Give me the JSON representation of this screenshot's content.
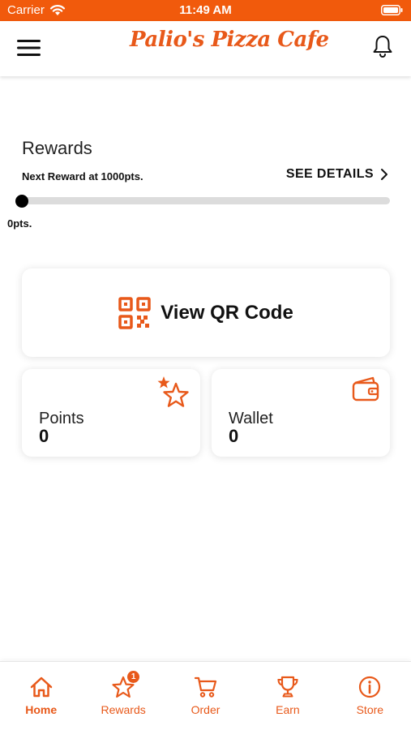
{
  "status_bar": {
    "carrier": "Carrier",
    "time": "11:49 AM"
  },
  "header": {
    "logo_text": "Palio's Pizza Cafe"
  },
  "rewards": {
    "title": "Rewards",
    "next_reward": "Next Reward at 1000pts.",
    "see_details": "SEE DETAILS",
    "current_points_label": "0pts.",
    "progress_fraction": 0
  },
  "qr": {
    "label": "View QR Code"
  },
  "points_card": {
    "label": "Points",
    "value": "0"
  },
  "wallet_card": {
    "label": "Wallet",
    "value": "0"
  },
  "tabs": [
    {
      "label": "Home",
      "icon": "home-icon",
      "active": true
    },
    {
      "label": "Rewards",
      "icon": "star-icon",
      "badge": "1"
    },
    {
      "label": "Order",
      "icon": "cart-icon"
    },
    {
      "label": "Earn",
      "icon": "trophy-icon"
    },
    {
      "label": "Store",
      "icon": "info-icon"
    }
  ],
  "colors": {
    "brand": "#e8591a",
    "status_bar": "#f15a0c"
  }
}
